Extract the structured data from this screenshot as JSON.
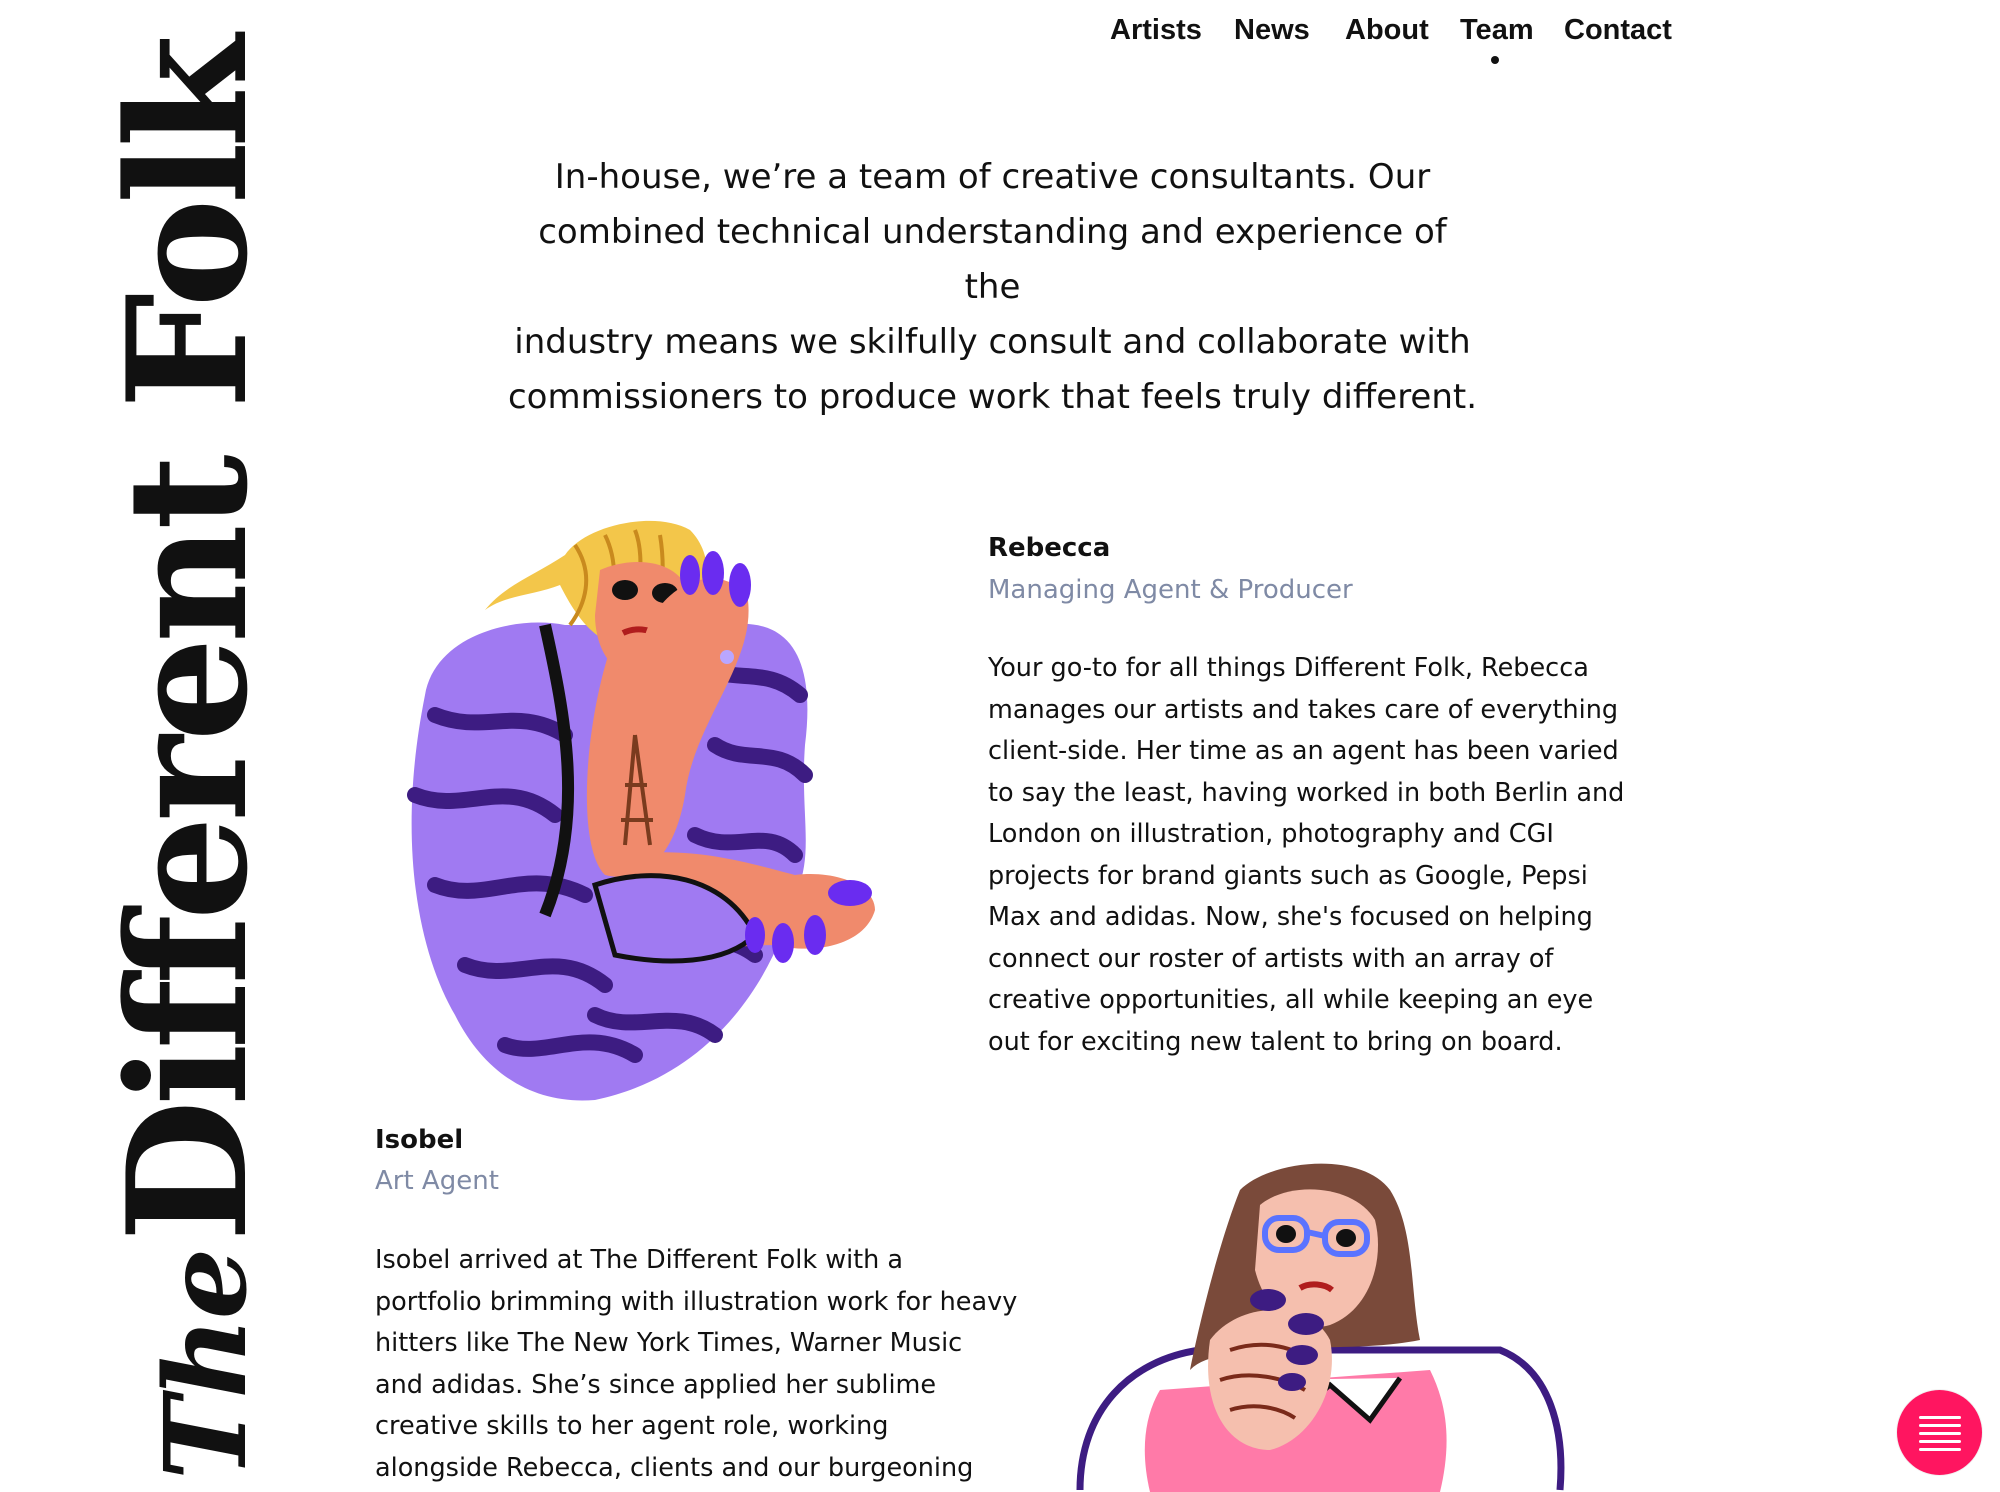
{
  "brand": {
    "logo_the": "The",
    "logo_main": "Different Folk"
  },
  "nav": {
    "items": [
      {
        "label": "Artists"
      },
      {
        "label": "News"
      },
      {
        "label": "About"
      },
      {
        "label": "Team",
        "active": true
      },
      {
        "label": "Contact"
      }
    ]
  },
  "intro": {
    "lines": [
      "In-house, we’re a team of creative consultants. Our",
      "combined technical understanding and experience of the",
      "industry means we skilfully consult and collaborate with",
      "commissioners to produce work that feels truly different."
    ]
  },
  "team": [
    {
      "name": "Rebecca",
      "role": "Managing Agent & Producer",
      "bio_lines": [
        "Your go-to for all things Different Folk, Rebecca",
        "manages our artists and takes care of everything",
        "client-side. Her time as an agent has been varied",
        "to say the least, having worked in both Berlin and",
        "London on illustration, photography and CGI",
        "projects for brand giants such as Google, Pepsi",
        "Max and adidas. Now, she's focused on helping",
        "connect our roster of artists with an array of",
        "creative opportunities, all while keeping an eye",
        "out for exciting new talent to bring on board."
      ]
    },
    {
      "name": "Isobel",
      "role": "Art Agent",
      "bio_lines": [
        "Isobel arrived at The Different Folk with a",
        "portfolio brimming with illustration work for heavy",
        "hitters like The New York Times, Warner Music",
        "and adidas. She’s since applied her sublime",
        "creative skills to her agent role, working",
        "alongside Rebecca, clients and our burgeoning"
      ]
    }
  ],
  "colors": {
    "accent": "#ff1560",
    "role_text": "#7f8aa5",
    "purple": "#8f62ef",
    "dark_purple": "#3d1c82",
    "skin": "#f08a6c",
    "pink": "#ff7aa8"
  },
  "icons": {
    "menu": "menu-icon"
  }
}
